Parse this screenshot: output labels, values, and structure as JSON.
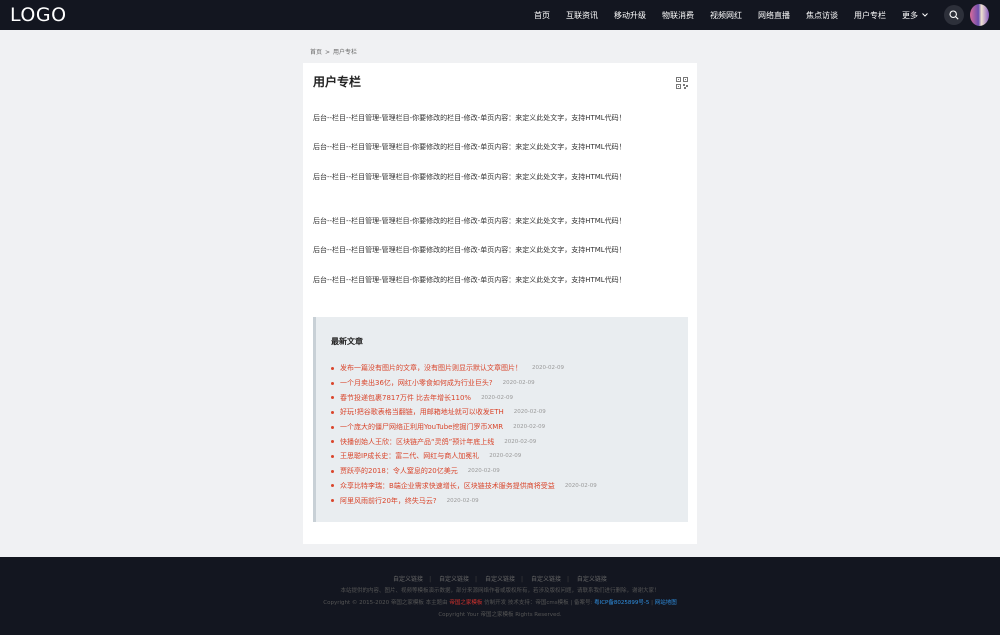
{
  "header": {
    "logo": "LOGO",
    "nav": [
      "首页",
      "互联资讯",
      "移动升级",
      "物联消费",
      "视频网红",
      "网络直播",
      "焦点访谈",
      "用户专栏"
    ],
    "more": "更多"
  },
  "breadcrumb": {
    "home": "首页",
    "separator": ">",
    "current": "用户专栏"
  },
  "main": {
    "title": "用户专栏",
    "paragraphs": [
      "后台--栏目--栏目管理-管理栏目-你要修改的栏目-修改-单页内容：来定义此处文字，支持HTML代码！",
      "后台--栏目--栏目管理-管理栏目-你要修改的栏目-修改-单页内容：来定义此处文字，支持HTML代码！",
      "后台--栏目--栏目管理-管理栏目-你要修改的栏目-修改-单页内容：来定义此处文字，支持HTML代码！",
      "后台--栏目--栏目管理-管理栏目-你要修改的栏目-修改-单页内容：来定义此处文字，支持HTML代码！",
      "后台--栏目--栏目管理-管理栏目-你要修改的栏目-修改-单页内容：来定义此处文字，支持HTML代码！",
      "后台--栏目--栏目管理-管理栏目-你要修改的栏目-修改-单页内容：来定义此处文字，支持HTML代码！"
    ]
  },
  "recent": {
    "title": "最新文章",
    "items": [
      {
        "title": "发布一篇没有图片的文章，没有图片则显示默认文章图片！",
        "date": "2020-02-09"
      },
      {
        "title": "一个月卖出36亿，网红小零食如何成为行业巨头?",
        "date": "2020-02-09"
      },
      {
        "title": "春节投递包裹7817万件 比去年增长110%",
        "date": "2020-02-09"
      },
      {
        "title": "好玩!把谷歌表格当翻链，用邮箱地址就可以收发ETH",
        "date": "2020-02-09"
      },
      {
        "title": "一个庞大的僵尸网络正利用YouTube挖掘门罗币XMR",
        "date": "2020-02-09"
      },
      {
        "title": "快播创始人王欣：区块链产品“灵鸽”预计年底上线",
        "date": "2020-02-09"
      },
      {
        "title": "王思聪IP成长史：富二代、网红与商人加冕礼",
        "date": "2020-02-09"
      },
      {
        "title": "贾跃亭的2018：令人窒息的20亿美元",
        "date": "2020-02-09"
      },
      {
        "title": "众享比特李瑞：B端企业需求快速增长，区块链技术服务提供商将受益",
        "date": "2020-02-09"
      },
      {
        "title": "阿里风雨前行20年，终失马云?",
        "date": "2020-02-09"
      }
    ]
  },
  "footer": {
    "links": [
      "自定义链接",
      "自定义链接",
      "自定义链接",
      "自定义链接",
      "自定义链接"
    ],
    "notice": "本站提供的内容、图片、视频等模板演示数据，部分来源网络作者或版权所有，若涉及版权问题，请联系我们进行删除，谢谢大家！",
    "copyright_prefix": "Copyright © 2015-2020 帝国之家模板 本主题由",
    "copyright_brand": "帝国之家模板",
    "copyright_middle": "仿制开发 技术支持：帝国cms模板 | 备案号:",
    "icp": "粤ICP备8025899号-5",
    "sitemap": "网站地图",
    "bottom": "Copyright Your 帝国之家模板 Rights Reserved."
  },
  "colors": {
    "header_bg": "#131620",
    "accent_red": "#d9452b",
    "link_blue": "#2f8fe0"
  }
}
